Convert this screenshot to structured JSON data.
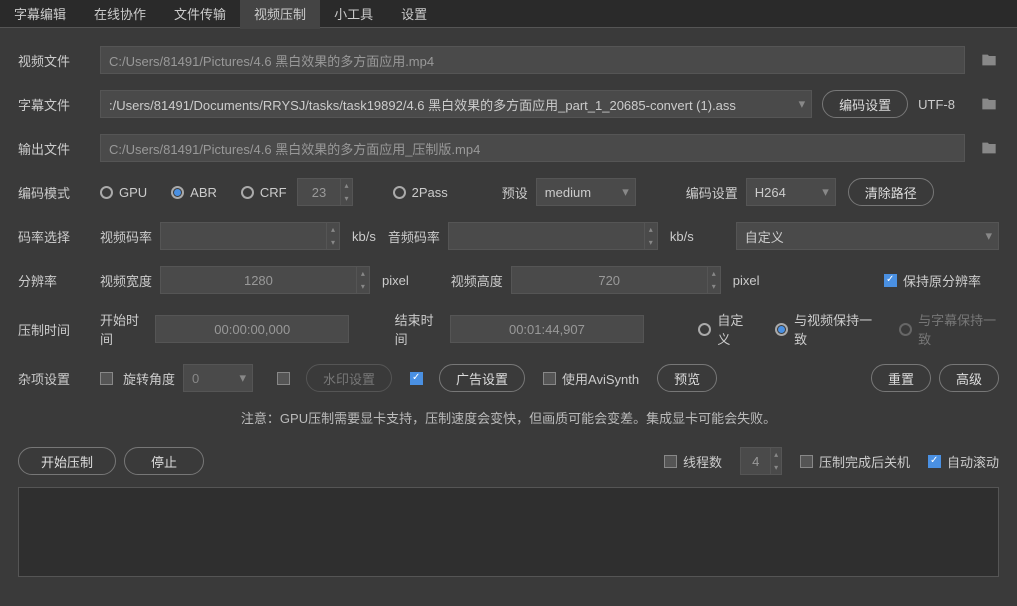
{
  "tabs": [
    "字幕编辑",
    "在线协作",
    "文件传输",
    "视频压制",
    "小工具",
    "设置"
  ],
  "active_tab": 3,
  "video_file": {
    "label": "视频文件",
    "value": "C:/Users/81491/Pictures/4.6 黑白效果的多方面应用.mp4"
  },
  "subtitle_file": {
    "label": "字幕文件",
    "value": ":/Users/81491/Documents/RRYSJ/tasks/task19892/4.6 黑白效果的多方面应用_part_1_20685-convert (1).ass",
    "encoding_btn": "编码设置",
    "encoding": "UTF-8"
  },
  "output_file": {
    "label": "输出文件",
    "value": "C:/Users/81491/Pictures/4.6 黑白效果的多方面应用_压制版.mp4"
  },
  "encode_mode": {
    "label": "编码模式",
    "options": [
      "GPU",
      "ABR",
      "CRF",
      "2Pass"
    ],
    "selected": "ABR",
    "crf_value": "23",
    "preset_label": "预设",
    "preset": "medium",
    "codec_label": "编码设置",
    "codec": "H264",
    "clear_btn": "清除路径"
  },
  "bitrate": {
    "label": "码率选择",
    "video_label": "视频码率",
    "video_unit": "kb/s",
    "audio_label": "音频码率",
    "audio_unit": "kb/s",
    "custom": "自定义"
  },
  "resolution": {
    "label": "分辨率",
    "width_label": "视频宽度",
    "width": "1280",
    "width_unit": "pixel",
    "height_label": "视频高度",
    "height": "720",
    "height_unit": "pixel",
    "keep_label": "保持原分辨率",
    "keep": true
  },
  "timing": {
    "label": "压制时间",
    "start_label": "开始时间",
    "start": "00:00:00,000",
    "end_label": "结束时间",
    "end": "00:01:44,907",
    "opts": [
      "自定义",
      "与视频保持一致",
      "与字幕保持一致"
    ],
    "selected": 1
  },
  "misc": {
    "label": "杂项设置",
    "rotate_label": "旋转角度",
    "rotate_value": "0",
    "watermark_btn": "水印设置",
    "ad_btn": "广告设置",
    "avisynth_label": "使用AviSynth",
    "preview_btn": "预览",
    "reset_btn": "重置",
    "advanced_btn": "高级"
  },
  "note": "注意：GPU压制需要显卡支持，压制速度会变快，但画质可能会变差。集成显卡可能会失败。",
  "actions": {
    "start": "开始压制",
    "stop": "停止",
    "threads_label": "线程数",
    "threads": "4",
    "shutdown_label": "压制完成后关机",
    "autoscroll_label": "自动滚动",
    "autoscroll": true
  }
}
